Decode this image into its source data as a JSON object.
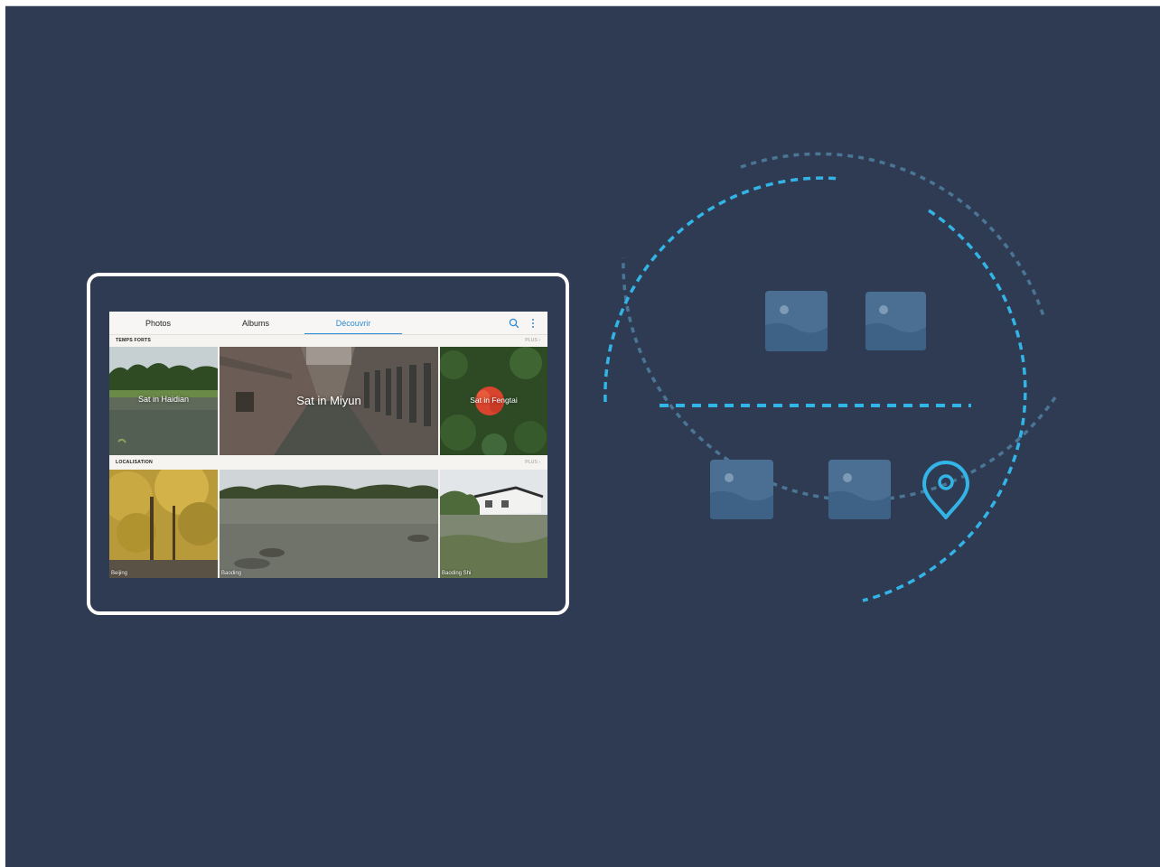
{
  "tabs": [
    {
      "label": "Photos"
    },
    {
      "label": "Albums"
    },
    {
      "label": "Découvrir",
      "active": true
    }
  ],
  "icons": {
    "search": "search-icon",
    "more": "more-vertical-icon",
    "pin": "location-pin-icon",
    "photo": "image-placeholder-icon"
  },
  "highlights": {
    "title": "TEMPS FORTS",
    "more": "PLUS",
    "tiles": [
      {
        "caption": "Sat in Haidian"
      },
      {
        "caption": "Sat in Miyun"
      },
      {
        "caption": "Sat in Fengtai"
      }
    ]
  },
  "location": {
    "title": "LOCALISATION",
    "more": "PLUS",
    "tiles": [
      {
        "place": "Beijing"
      },
      {
        "place": "Baoding"
      },
      {
        "place": "Baoding Shi"
      }
    ]
  },
  "colors": {
    "background": "#2f3b53",
    "accent": "#33b4e6",
    "active_tab": "#2d8bd6",
    "photo_icon": "#4a6f92"
  }
}
